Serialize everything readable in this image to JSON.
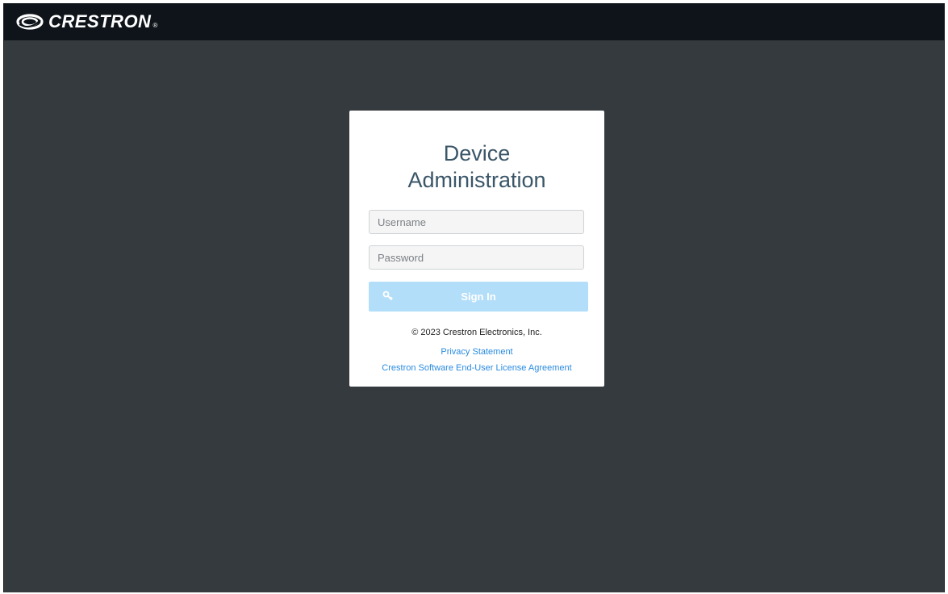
{
  "header": {
    "brand": "CRESTRON",
    "registered_mark": "®"
  },
  "login": {
    "title_line1": "Device",
    "title_line2": "Administration",
    "username_placeholder": "Username",
    "password_placeholder": "Password",
    "username_value": "",
    "password_value": "",
    "sign_in_label": "Sign In",
    "sign_in_icon": "key-icon"
  },
  "footer": {
    "copyright": "© 2023 Crestron Electronics, Inc.",
    "privacy_link": "Privacy Statement",
    "eula_link": "Crestron Software End-User License Agreement"
  },
  "colors": {
    "background": "#353a3f",
    "topbar": "#0e1419",
    "title": "#3a5668",
    "button_disabled": "#b3def9",
    "link": "#2a8be0"
  }
}
